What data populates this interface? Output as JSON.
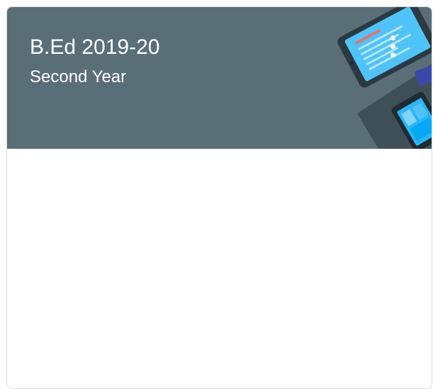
{
  "class_card": {
    "title": "B.Ed 2019-20",
    "section": "Second Year",
    "more_icon": "more-vert-icon",
    "header_color": "#5a6e78",
    "illustration_icon": "tablet-devices-illustration"
  }
}
